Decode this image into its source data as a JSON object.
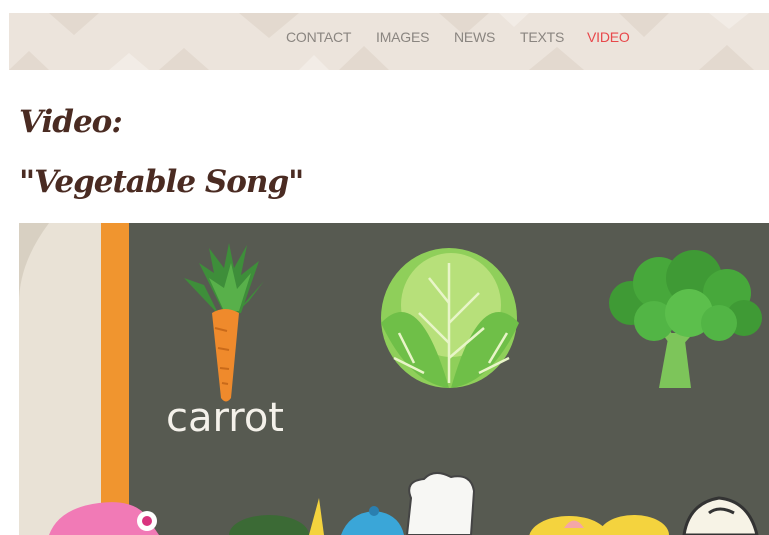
{
  "nav": {
    "items": [
      {
        "label": "CONTACT"
      },
      {
        "label": "IMAGES"
      },
      {
        "label": "NEWS"
      },
      {
        "label": "TEXTS"
      },
      {
        "label": "VIDEO",
        "active": true
      }
    ],
    "active_color": "#e8484b",
    "background": "#ece4dc"
  },
  "page": {
    "heading": "Video:",
    "subheading": "\"Vegetable Song\""
  },
  "video": {
    "caption": "carrot",
    "icons": [
      "carrot-illustration",
      "cabbage-illustration",
      "broccoli-illustration"
    ]
  },
  "colors": {
    "title": "#4a2b22",
    "chalkboard": "#5a5c53",
    "orange_stripe": "#f0952f"
  }
}
